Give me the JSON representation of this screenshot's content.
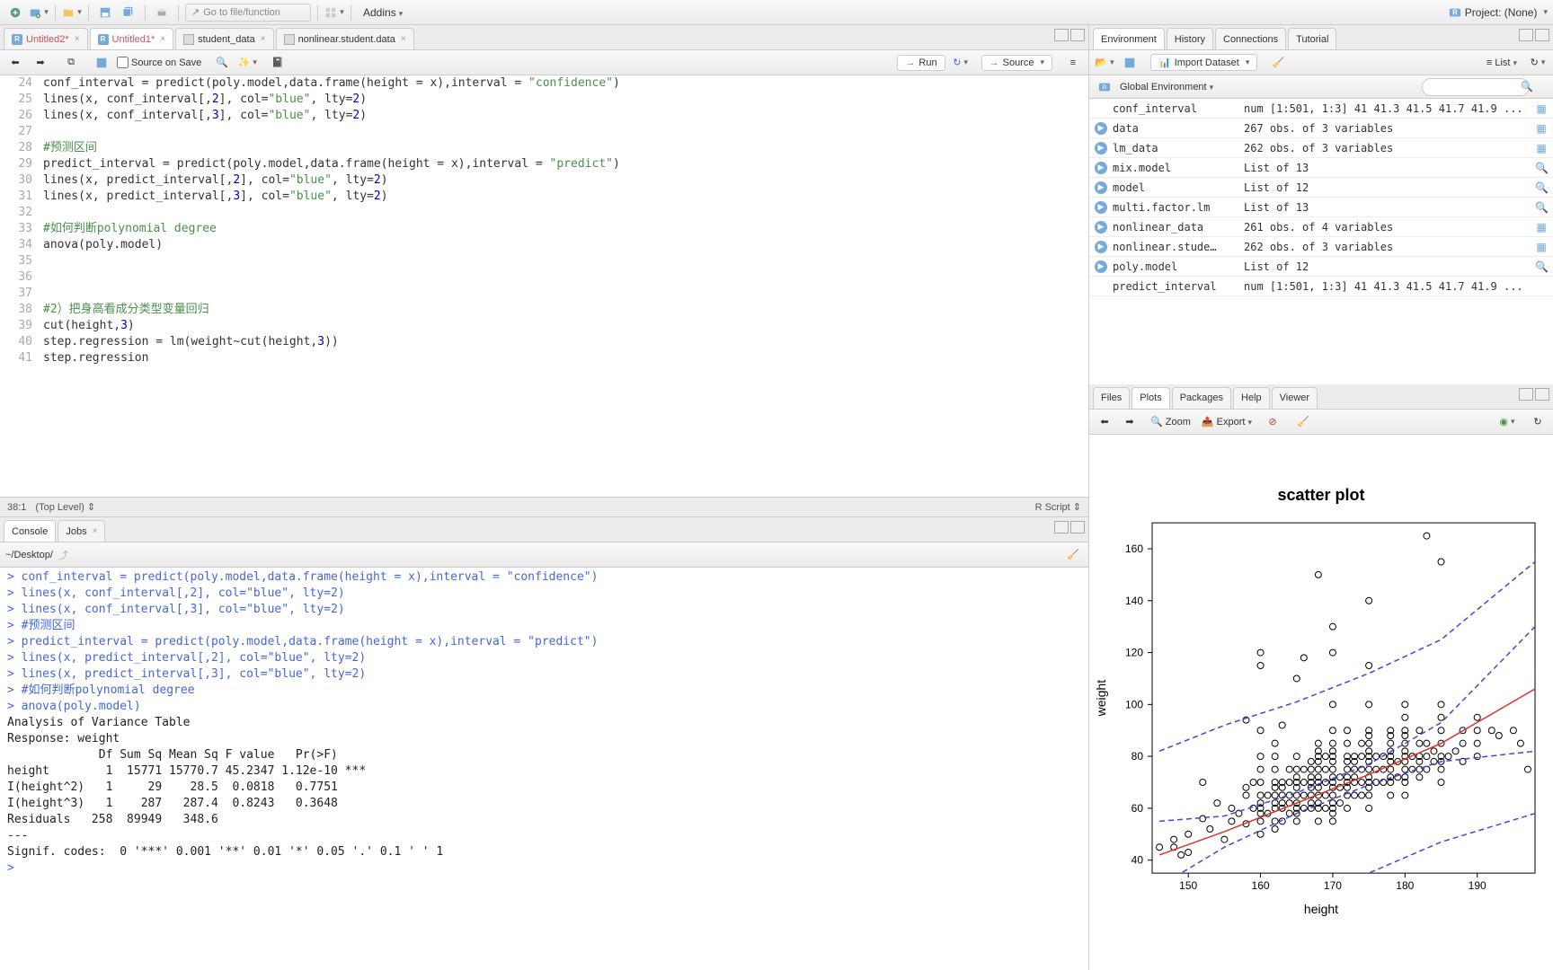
{
  "main_toolbar": {
    "goto_placeholder": "Go to file/function",
    "addins": "Addins",
    "project": "Project: (None)"
  },
  "source": {
    "tabs": [
      {
        "label": "Untitled2*",
        "type": "r",
        "dirty": true,
        "active": false
      },
      {
        "label": "Untitled1*",
        "type": "r",
        "dirty": true,
        "active": true
      },
      {
        "label": "student_data",
        "type": "data",
        "dirty": false,
        "active": false
      },
      {
        "label": "nonlinear.student.data",
        "type": "data",
        "dirty": false,
        "active": false
      }
    ],
    "source_on_save": "Source on Save",
    "run": "Run",
    "source_btn": "Source",
    "cursor_pos": "38:1",
    "scope": "(Top Level)",
    "rscript": "R Script",
    "lines": [
      {
        "n": 24,
        "text": "conf_interval = predict(poly.model,data.frame(height = x),interval = \"confidence\")"
      },
      {
        "n": 25,
        "text": "lines(x, conf_interval[,2], col=\"blue\", lty=2)"
      },
      {
        "n": 26,
        "text": "lines(x, conf_interval[,3], col=\"blue\", lty=2)"
      },
      {
        "n": 27,
        "text": ""
      },
      {
        "n": 28,
        "text": "#预测区间",
        "comment": true
      },
      {
        "n": 29,
        "text": "predict_interval = predict(poly.model,data.frame(height = x),interval = \"predict\")"
      },
      {
        "n": 30,
        "text": "lines(x, predict_interval[,2], col=\"blue\", lty=2)"
      },
      {
        "n": 31,
        "text": "lines(x, predict_interval[,3], col=\"blue\", lty=2)"
      },
      {
        "n": 32,
        "text": ""
      },
      {
        "n": 33,
        "text": "#如何判断polynomial degree",
        "comment": true
      },
      {
        "n": 34,
        "text": "anova(poly.model)"
      },
      {
        "n": 35,
        "text": ""
      },
      {
        "n": 36,
        "text": ""
      },
      {
        "n": 37,
        "text": ""
      },
      {
        "n": 38,
        "text": "#2）把身高看成分类型变量回归",
        "comment": true
      },
      {
        "n": 39,
        "text": "cut(height,3)"
      },
      {
        "n": 40,
        "text": "step.regression = lm(weight~cut(height,3))"
      },
      {
        "n": 41,
        "text": "step.regression"
      }
    ]
  },
  "console": {
    "tabs": [
      "Console",
      "Jobs"
    ],
    "wd": "~/Desktop/",
    "lines": [
      {
        "t": "p",
        "text": "conf_interval = predict(poly.model,data.frame(height = x),interval = \"confidence\")"
      },
      {
        "t": "p",
        "text": "lines(x, conf_interval[,2], col=\"blue\", lty=2)"
      },
      {
        "t": "p",
        "text": "lines(x, conf_interval[,3], col=\"blue\", lty=2)"
      },
      {
        "t": "p",
        "text": "#预测区间"
      },
      {
        "t": "p",
        "text": "predict_interval = predict(poly.model,data.frame(height = x),interval = \"predict\")"
      },
      {
        "t": "p",
        "text": "lines(x, predict_interval[,2], col=\"blue\", lty=2)"
      },
      {
        "t": "p",
        "text": "lines(x, predict_interval[,3], col=\"blue\", lty=2)"
      },
      {
        "t": "p",
        "text": "#如何判断polynomial degree"
      },
      {
        "t": "p",
        "text": "anova(poly.model)"
      },
      {
        "t": "o",
        "text": "Analysis of Variance Table"
      },
      {
        "t": "o",
        "text": ""
      },
      {
        "t": "o",
        "text": "Response: weight"
      },
      {
        "t": "o",
        "text": "             Df Sum Sq Mean Sq F value   Pr(>F)    "
      },
      {
        "t": "o",
        "text": "height        1  15771 15770.7 45.2347 1.12e-10 ***"
      },
      {
        "t": "o",
        "text": "I(height^2)   1     29    28.5  0.0818   0.7751    "
      },
      {
        "t": "o",
        "text": "I(height^3)   1    287   287.4  0.8243   0.3648    "
      },
      {
        "t": "o",
        "text": "Residuals   258  89949   348.6                     "
      },
      {
        "t": "o",
        "text": "---"
      },
      {
        "t": "o",
        "text": "Signif. codes:  0 '***' 0.001 '**' 0.01 '*' 0.05 '.' 0.1 ' ' 1"
      },
      {
        "t": "c",
        "text": ""
      }
    ]
  },
  "env": {
    "tabs": [
      "Environment",
      "History",
      "Connections",
      "Tutorial"
    ],
    "import": "Import Dataset",
    "scope": "Global Environment",
    "view": "List",
    "items": [
      {
        "name": "conf_interval",
        "val": "num [1:501, 1:3] 41 41.3 41.5 41.7 41.9 ...",
        "icon": "grid"
      },
      {
        "name": "data",
        "val": "267 obs. of 3 variables",
        "icon": "grid",
        "exp": true
      },
      {
        "name": "lm_data",
        "val": "262 obs. of 3 variables",
        "icon": "grid",
        "exp": true
      },
      {
        "name": "mix.model",
        "val": "List of 13",
        "icon": "lens",
        "exp": true
      },
      {
        "name": "model",
        "val": "List of 12",
        "icon": "lens",
        "exp": true
      },
      {
        "name": "multi.factor.lm",
        "val": "List of 13",
        "icon": "lens",
        "exp": true
      },
      {
        "name": "nonlinear_data",
        "val": "261 obs. of 4 variables",
        "icon": "grid",
        "exp": true
      },
      {
        "name": "nonlinear.stude…",
        "val": "262 obs. of 3 variables",
        "icon": "grid",
        "exp": true
      },
      {
        "name": "poly.model",
        "val": "List of 12",
        "icon": "lens",
        "exp": true
      },
      {
        "name": "predict_interval",
        "val": "num [1:501, 1:3] 41 41.3 41.5 41.7 41.9 ..."
      }
    ]
  },
  "plots": {
    "tabs": [
      "Files",
      "Plots",
      "Packages",
      "Help",
      "Viewer"
    ],
    "zoom": "Zoom",
    "export": "Export"
  },
  "chart_data": {
    "type": "scatter",
    "title": "scatter plot",
    "xlabel": "height",
    "ylabel": "weight",
    "xlim": [
      145,
      198
    ],
    "ylim": [
      35,
      170
    ],
    "xticks": [
      150,
      160,
      170,
      180,
      190
    ],
    "yticks": [
      40,
      60,
      80,
      100,
      120,
      140,
      160
    ],
    "points": [
      [
        146,
        45
      ],
      [
        148,
        45
      ],
      [
        148,
        48
      ],
      [
        149,
        42
      ],
      [
        150,
        43
      ],
      [
        150,
        50
      ],
      [
        152,
        56
      ],
      [
        152,
        70
      ],
      [
        153,
        52
      ],
      [
        154,
        62
      ],
      [
        155,
        48
      ],
      [
        156,
        55
      ],
      [
        156,
        60
      ],
      [
        157,
        58
      ],
      [
        158,
        54
      ],
      [
        158,
        68
      ],
      [
        158,
        94
      ],
      [
        158,
        65
      ],
      [
        159,
        60
      ],
      [
        159,
        70
      ],
      [
        160,
        50
      ],
      [
        160,
        55
      ],
      [
        160,
        58
      ],
      [
        160,
        60
      ],
      [
        160,
        62
      ],
      [
        160,
        65
      ],
      [
        160,
        70
      ],
      [
        160,
        75
      ],
      [
        160,
        80
      ],
      [
        160,
        90
      ],
      [
        160,
        115
      ],
      [
        160,
        120
      ],
      [
        161,
        58
      ],
      [
        161,
        65
      ],
      [
        162,
        52
      ],
      [
        162,
        55
      ],
      [
        162,
        60
      ],
      [
        162,
        62
      ],
      [
        162,
        65
      ],
      [
        162,
        68
      ],
      [
        162,
        70
      ],
      [
        162,
        75
      ],
      [
        162,
        80
      ],
      [
        162,
        85
      ],
      [
        163,
        55
      ],
      [
        163,
        60
      ],
      [
        163,
        62
      ],
      [
        163,
        65
      ],
      [
        163,
        68
      ],
      [
        163,
        70
      ],
      [
        163,
        92
      ],
      [
        164,
        58
      ],
      [
        164,
        62
      ],
      [
        164,
        65
      ],
      [
        164,
        70
      ],
      [
        164,
        75
      ],
      [
        165,
        55
      ],
      [
        165,
        58
      ],
      [
        165,
        60
      ],
      [
        165,
        62
      ],
      [
        165,
        65
      ],
      [
        165,
        68
      ],
      [
        165,
        70
      ],
      [
        165,
        72
      ],
      [
        165,
        75
      ],
      [
        165,
        80
      ],
      [
        165,
        110
      ],
      [
        166,
        60
      ],
      [
        166,
        65
      ],
      [
        166,
        70
      ],
      [
        166,
        75
      ],
      [
        166,
        118
      ],
      [
        167,
        60
      ],
      [
        167,
        62
      ],
      [
        167,
        65
      ],
      [
        167,
        68
      ],
      [
        167,
        70
      ],
      [
        167,
        72
      ],
      [
        167,
        75
      ],
      [
        167,
        78
      ],
      [
        168,
        55
      ],
      [
        168,
        60
      ],
      [
        168,
        62
      ],
      [
        168,
        65
      ],
      [
        168,
        68
      ],
      [
        168,
        70
      ],
      [
        168,
        72
      ],
      [
        168,
        75
      ],
      [
        168,
        78
      ],
      [
        168,
        80
      ],
      [
        168,
        82
      ],
      [
        168,
        85
      ],
      [
        168,
        150
      ],
      [
        169,
        60
      ],
      [
        169,
        65
      ],
      [
        169,
        70
      ],
      [
        169,
        75
      ],
      [
        169,
        80
      ],
      [
        170,
        55
      ],
      [
        170,
        58
      ],
      [
        170,
        60
      ],
      [
        170,
        62
      ],
      [
        170,
        65
      ],
      [
        170,
        68
      ],
      [
        170,
        70
      ],
      [
        170,
        72
      ],
      [
        170,
        75
      ],
      [
        170,
        78
      ],
      [
        170,
        80
      ],
      [
        170,
        82
      ],
      [
        170,
        85
      ],
      [
        170,
        90
      ],
      [
        170,
        100
      ],
      [
        170,
        120
      ],
      [
        170,
        130
      ],
      [
        171,
        62
      ],
      [
        171,
        68
      ],
      [
        171,
        72
      ],
      [
        172,
        60
      ],
      [
        172,
        65
      ],
      [
        172,
        68
      ],
      [
        172,
        70
      ],
      [
        172,
        72
      ],
      [
        172,
        75
      ],
      [
        172,
        78
      ],
      [
        172,
        80
      ],
      [
        172,
        85
      ],
      [
        172,
        90
      ],
      [
        173,
        65
      ],
      [
        173,
        70
      ],
      [
        173,
        72
      ],
      [
        173,
        75
      ],
      [
        173,
        78
      ],
      [
        173,
        80
      ],
      [
        174,
        65
      ],
      [
        174,
        70
      ],
      [
        174,
        75
      ],
      [
        174,
        80
      ],
      [
        174,
        85
      ],
      [
        175,
        60
      ],
      [
        175,
        65
      ],
      [
        175,
        68
      ],
      [
        175,
        70
      ],
      [
        175,
        72
      ],
      [
        175,
        75
      ],
      [
        175,
        78
      ],
      [
        175,
        80
      ],
      [
        175,
        82
      ],
      [
        175,
        85
      ],
      [
        175,
        88
      ],
      [
        175,
        90
      ],
      [
        175,
        100
      ],
      [
        175,
        115
      ],
      [
        175,
        140
      ],
      [
        176,
        70
      ],
      [
        176,
        75
      ],
      [
        176,
        80
      ],
      [
        177,
        70
      ],
      [
        177,
        75
      ],
      [
        177,
        80
      ],
      [
        178,
        65
      ],
      [
        178,
        70
      ],
      [
        178,
        72
      ],
      [
        178,
        75
      ],
      [
        178,
        78
      ],
      [
        178,
        80
      ],
      [
        178,
        82
      ],
      [
        178,
        85
      ],
      [
        178,
        88
      ],
      [
        178,
        90
      ],
      [
        179,
        72
      ],
      [
        179,
        78
      ],
      [
        180,
        65
      ],
      [
        180,
        70
      ],
      [
        180,
        72
      ],
      [
        180,
        75
      ],
      [
        180,
        78
      ],
      [
        180,
        80
      ],
      [
        180,
        82
      ],
      [
        180,
        85
      ],
      [
        180,
        88
      ],
      [
        180,
        90
      ],
      [
        180,
        95
      ],
      [
        180,
        100
      ],
      [
        181,
        75
      ],
      [
        181,
        80
      ],
      [
        182,
        72
      ],
      [
        182,
        75
      ],
      [
        182,
        78
      ],
      [
        182,
        80
      ],
      [
        182,
        85
      ],
      [
        182,
        90
      ],
      [
        183,
        75
      ],
      [
        183,
        80
      ],
      [
        183,
        85
      ],
      [
        183,
        165
      ],
      [
        184,
        78
      ],
      [
        184,
        82
      ],
      [
        185,
        70
      ],
      [
        185,
        75
      ],
      [
        185,
        78
      ],
      [
        185,
        80
      ],
      [
        185,
        85
      ],
      [
        185,
        90
      ],
      [
        185,
        95
      ],
      [
        185,
        100
      ],
      [
        185,
        155
      ],
      [
        186,
        80
      ],
      [
        187,
        82
      ],
      [
        188,
        78
      ],
      [
        188,
        85
      ],
      [
        188,
        90
      ],
      [
        190,
        80
      ],
      [
        190,
        85
      ],
      [
        190,
        90
      ],
      [
        190,
        95
      ],
      [
        192,
        90
      ],
      [
        193,
        88
      ],
      [
        195,
        90
      ],
      [
        196,
        85
      ],
      [
        197,
        75
      ]
    ],
    "fit_line": [
      [
        146,
        42
      ],
      [
        155,
        51
      ],
      [
        165,
        62
      ],
      [
        175,
        73
      ],
      [
        185,
        85
      ],
      [
        198,
        106
      ]
    ],
    "conf_upper": [
      [
        146,
        55
      ],
      [
        155,
        57
      ],
      [
        165,
        66
      ],
      [
        175,
        77
      ],
      [
        185,
        93
      ],
      [
        198,
        130
      ]
    ],
    "conf_lower": [
      [
        146,
        30
      ],
      [
        155,
        45
      ],
      [
        165,
        58
      ],
      [
        175,
        69
      ],
      [
        185,
        78
      ],
      [
        198,
        82
      ]
    ],
    "pred_upper": [
      [
        146,
        82
      ],
      [
        155,
        92
      ],
      [
        165,
        101
      ],
      [
        175,
        112
      ],
      [
        185,
        125
      ],
      [
        198,
        155
      ]
    ],
    "pred_lower": [
      [
        146,
        5
      ],
      [
        155,
        14
      ],
      [
        165,
        24
      ],
      [
        175,
        35
      ],
      [
        185,
        47
      ],
      [
        198,
        58
      ]
    ]
  }
}
